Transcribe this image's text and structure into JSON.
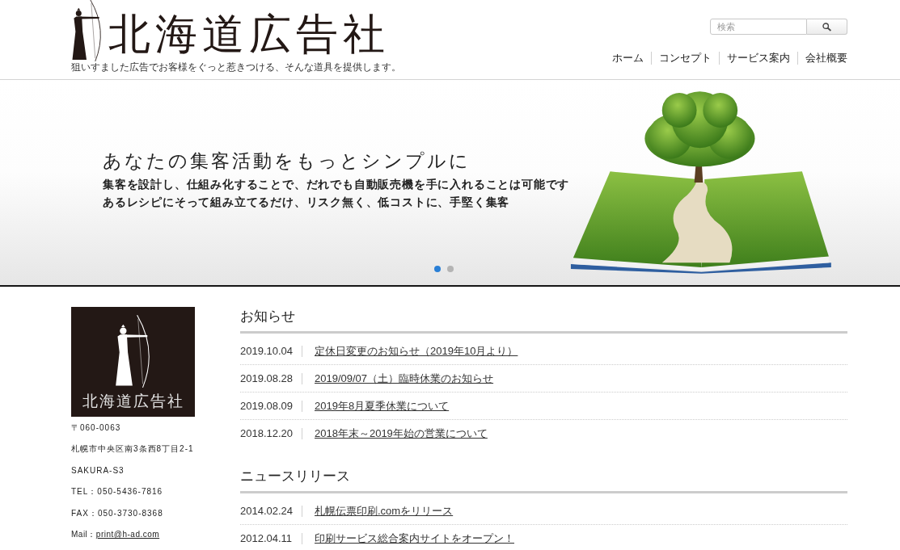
{
  "header": {
    "logo_title": "北海道広告社",
    "tagline": "狙いすました広告でお客様をぐっと惹きつける、そんな道具を提供します。",
    "search": {
      "placeholder": "検索"
    },
    "nav": [
      "ホーム",
      "コンセプト",
      "サービス案内",
      "会社概要"
    ]
  },
  "hero": {
    "heading": "あなたの集客活動をもっとシンプルに",
    "lines": [
      "集客を設計し、仕組み化することで、だれでも自動販売機を手に入れることは可能です",
      "あるレシピにそって組み立てるだけ、リスク無く、低コストに、手堅く集客"
    ],
    "slides": [
      {
        "selected": true
      },
      {
        "selected": false
      }
    ]
  },
  "sidebar": {
    "logo_title": "北海道広告社",
    "address_lines": [
      "〒060-0063",
      "札幌市中央区南3条西8丁目2-1",
      "SAKURA-S3",
      "TEL：050-5436-7816",
      "FAX：050-3730-8368"
    ],
    "mail": {
      "label": "Mail：",
      "address": "print@h-ad.com"
    }
  },
  "sections": [
    {
      "title": "お知らせ",
      "items": [
        {
          "date": "2019.10.04",
          "title": "定休日変更のお知らせ（2019年10月より）"
        },
        {
          "date": "2019.08.28",
          "title": "2019/09/07（土）臨時休業のお知らせ"
        },
        {
          "date": "2019.08.09",
          "title": "2019年8月夏季休業について"
        },
        {
          "date": "2018.12.20",
          "title": "2018年末～2019年始の営業について"
        }
      ]
    },
    {
      "title": "ニュースリリース",
      "items": [
        {
          "date": "2014.02.24",
          "title": "札幌伝票印刷.comをリリース"
        },
        {
          "date": "2012.04.11",
          "title": "印刷サービス総合案内サイトをオープン！"
        }
      ]
    }
  ]
}
